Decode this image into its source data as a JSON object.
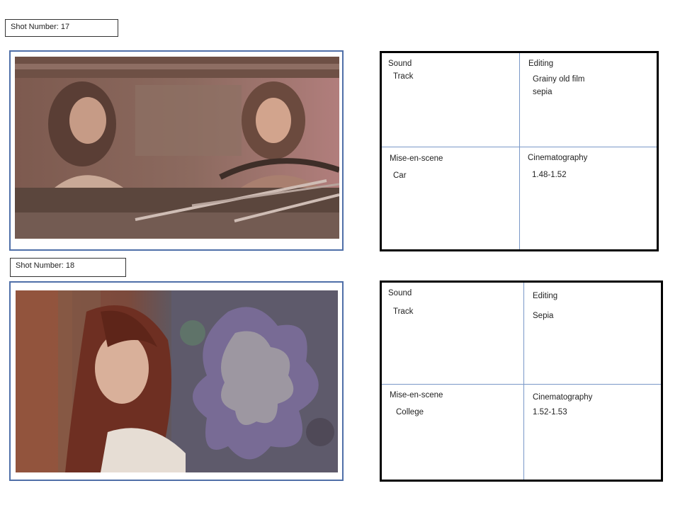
{
  "shots": [
    {
      "label": "Shot Number: 17",
      "sound": {
        "heading": "Sound",
        "value": "Track"
      },
      "editing": {
        "heading": "Editing",
        "value": "Grainy old film\nsepia"
      },
      "mise_en_scene": {
        "heading": "Mise-en-scene",
        "value": "Car"
      },
      "cinematography": {
        "heading": "Cinematography",
        "value": "1.48-1.52"
      }
    },
    {
      "label": "Shot Number: 18",
      "sound": {
        "heading": "Sound",
        "value": "Track"
      },
      "editing": {
        "heading": "Editing",
        "value": "Sepia"
      },
      "mise_en_scene": {
        "heading": "Mise-en-scene",
        "value": "College"
      },
      "cinematography": {
        "heading": "Cinematography",
        "value": "1.52-1.53"
      }
    }
  ]
}
